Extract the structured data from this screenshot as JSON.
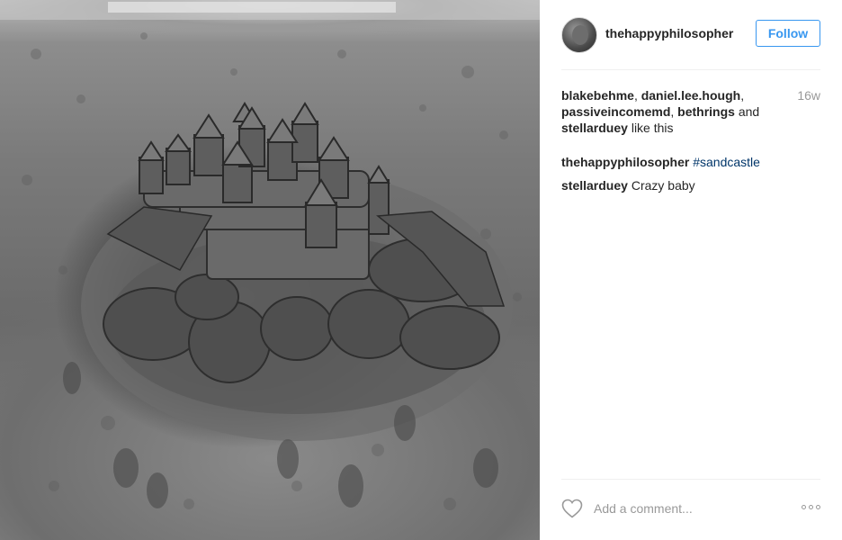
{
  "post": {
    "image_alt": "Sandcastle on a beach, black and white photo"
  },
  "header": {
    "username": "thehappyphilosopher",
    "follow_label": "Follow"
  },
  "likes": {
    "names": [
      "blakebehme",
      "daniel.lee.hough",
      "passiveincomemd",
      "bethrings",
      "stellarduey"
    ],
    "sep1": ", ",
    "sep2": ", ",
    "sep3": ", ",
    "and": " and ",
    "suffix": " like this",
    "time": "16w"
  },
  "comments": [
    {
      "user": "thehappyphilosopher",
      "text": "#sandcastle"
    },
    {
      "user": "stellarduey",
      "text": "Crazy baby"
    }
  ],
  "footer": {
    "comment_placeholder": "Add a comment..."
  },
  "colors": {
    "accent": "#3897f0",
    "hashtag": "#003569",
    "muted": "#999999"
  },
  "icons": [
    "heart-icon",
    "more-options-icon"
  ]
}
